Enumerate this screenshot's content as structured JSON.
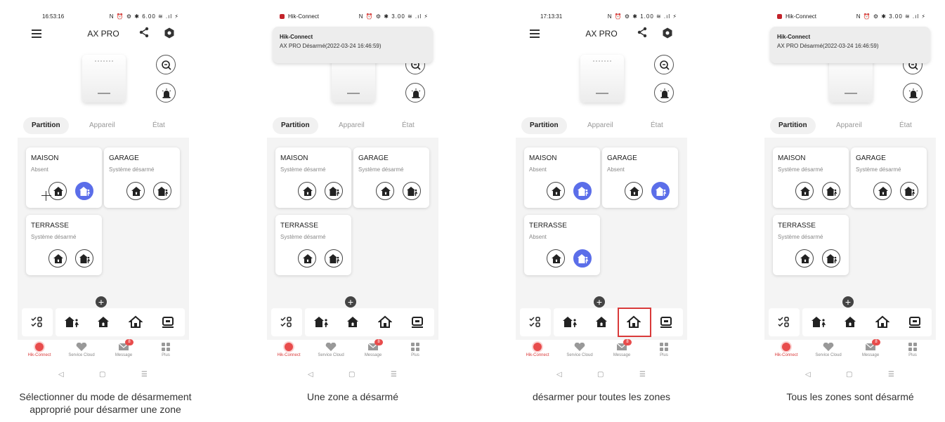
{
  "phones": [
    {
      "status_time": "16:53:16",
      "status_app": "",
      "status_icons": "N ⏰ ⚙ ✱ 6.00 ≋ .ıl ⚡",
      "title": "AX PRO",
      "notification": null,
      "tabs": [
        "Partition",
        "Appareil",
        "État"
      ],
      "zones": [
        {
          "name": "MAISON",
          "status": "Absent"
        },
        {
          "name": "GARAGE",
          "status": "Système désarmé"
        },
        {
          "name": "TERRASSE",
          "status": "Système désarmé"
        }
      ],
      "nav": [
        "Hik-Connect",
        "Service Cloud",
        "Message",
        "Plus"
      ],
      "message_badge": "8",
      "caption": "Sélectionner du mode de désarmement approprié pour désarmer une zone"
    },
    {
      "status_time": "",
      "status_app": "Hik-Connect",
      "status_icons": "N ⏰ ⚙ ✱ 3.00 ≋ .ıl ⚡",
      "title": "",
      "notification": {
        "title": "Hik-Connect",
        "body": "AX PRO Désarmé(2022-03-24 16:46:59)"
      },
      "tabs": [
        "Partition",
        "Appareil",
        "État"
      ],
      "zones": [
        {
          "name": "MAISON",
          "status": "Système désarmé"
        },
        {
          "name": "GARAGE",
          "status": "Système désarmé"
        },
        {
          "name": "TERRASSE",
          "status": "Système désarmé"
        }
      ],
      "nav": [
        "Hik-Connect",
        "Service Cloud",
        "Message",
        "Plus"
      ],
      "message_badge": "8",
      "caption": "Une zone a désarmé"
    },
    {
      "status_time": "17:13:31",
      "status_app": "",
      "status_icons": "N ⏰ ⚙ ✱ 1.00 ≋ .ıl ⚡",
      "title": "AX PRO",
      "notification": null,
      "tabs": [
        "Partition",
        "Appareil",
        "État"
      ],
      "zones": [
        {
          "name": "MAISON",
          "status": "Absent"
        },
        {
          "name": "GARAGE",
          "status": "Absent"
        },
        {
          "name": "TERRASSE",
          "status": "Absent"
        }
      ],
      "nav": [
        "Hik-Connect",
        "Service Cloud",
        "Message",
        "Plus"
      ],
      "message_badge": "8",
      "caption": "désarmer pour toutes les zones"
    },
    {
      "status_time": "",
      "status_app": "Hik-Connect",
      "status_icons": "N ⏰ ⚙ ✱ 3.00 ≋ .ıl ⚡",
      "title": "",
      "notification": {
        "title": "Hik-Connect",
        "body": "AX PRO Désarmé(2022-03-24 16:46:59)"
      },
      "tabs": [
        "Partition",
        "Appareil",
        "État"
      ],
      "zones": [
        {
          "name": "MAISON",
          "status": "Système désarmé"
        },
        {
          "name": "GARAGE",
          "status": "Système désarmé"
        },
        {
          "name": "TERRASSE",
          "status": "Système désarmé"
        }
      ],
      "nav": [
        "Hik-Connect",
        "Service Cloud",
        "Message",
        "Plus"
      ],
      "message_badge": "8",
      "caption": "Tous les zones sont désarmé"
    }
  ],
  "colors": {
    "accent": "#5b6ee9",
    "brand_red": "#e84c4c",
    "highlight": "#d93a3a"
  }
}
